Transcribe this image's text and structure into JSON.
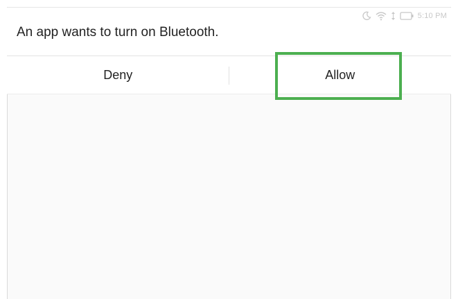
{
  "status_bar": {
    "time": "5:10 PM",
    "icons": [
      "moon-icon",
      "wifi-icon",
      "data-arrows-icon",
      "battery-icon"
    ]
  },
  "dialog": {
    "title": "An app wants to turn on Bluetooth.",
    "deny_label": "Deny",
    "allow_label": "Allow"
  },
  "highlight": {
    "color": "#4caf50",
    "target": "allow-button"
  }
}
